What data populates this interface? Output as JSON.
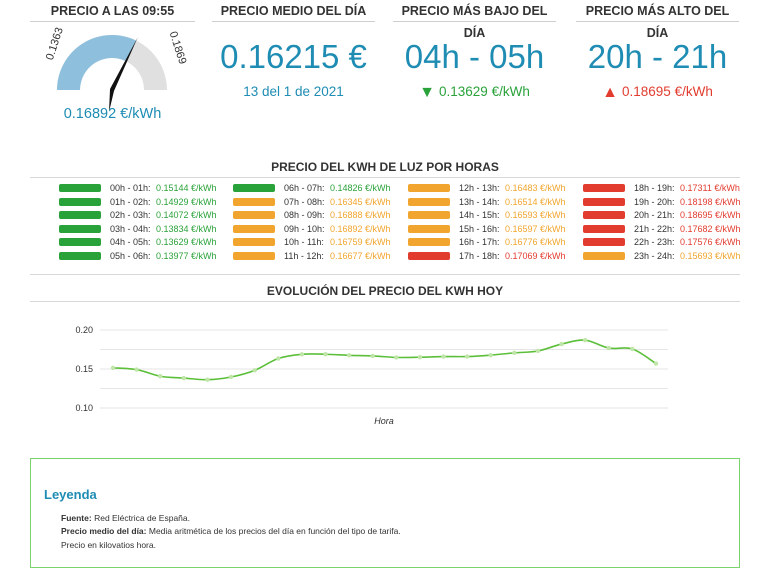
{
  "colors": {
    "accent": "#1e8cb3",
    "green": "#2aa23a",
    "orange": "#f2a52e",
    "red": "#e23c2f",
    "gauge_fill": "#8ec0dd",
    "gauge_bg": "#e0e0e0"
  },
  "current": {
    "title": "PRECIO A LAS 09:55",
    "gauge_min": "0.1363",
    "gauge_max": "0.1869",
    "gauge_value": 0.16892,
    "value_label": "0.16892 €/kWh"
  },
  "average": {
    "title": "PRECIO MEDIO DEL DÍA",
    "value": "0.16215 €",
    "date": "13 del 1 de 2021"
  },
  "lowest": {
    "title": "PRECIO MÁS BAJO DEL DÍA",
    "hours": "04h - 05h",
    "icon": "arrow-down-icon",
    "price": "0.13629 €/kWh"
  },
  "highest": {
    "title": "PRECIO MÁS ALTO DEL DÍA",
    "hours": "20h - 21h",
    "icon": "arrow-up-icon",
    "price": "0.18695 €/kWh"
  },
  "hourly": {
    "title": "PRECIO DEL KWH DE LUZ POR HORAS",
    "items": [
      {
        "range": "00h - 01h:",
        "price": "0.15144 €/kWh",
        "level": "green"
      },
      {
        "range": "01h - 02h:",
        "price": "0.14929 €/kWh",
        "level": "green"
      },
      {
        "range": "02h - 03h:",
        "price": "0.14072 €/kWh",
        "level": "green"
      },
      {
        "range": "03h - 04h:",
        "price": "0.13834 €/kWh",
        "level": "green"
      },
      {
        "range": "04h - 05h:",
        "price": "0.13629 €/kWh",
        "level": "green"
      },
      {
        "range": "05h - 06h:",
        "price": "0.13977 €/kWh",
        "level": "green"
      },
      {
        "range": "06h - 07h:",
        "price": "0.14826 €/kWh",
        "level": "green"
      },
      {
        "range": "07h - 08h:",
        "price": "0.16345 €/kWh",
        "level": "orange"
      },
      {
        "range": "08h - 09h:",
        "price": "0.16888 €/kWh",
        "level": "orange"
      },
      {
        "range": "09h - 10h:",
        "price": "0.16892 €/kWh",
        "level": "orange"
      },
      {
        "range": "10h - 11h:",
        "price": "0.16759 €/kWh",
        "level": "orange"
      },
      {
        "range": "11h - 12h:",
        "price": "0.16677 €/kWh",
        "level": "orange"
      },
      {
        "range": "12h - 13h:",
        "price": "0.16483 €/kWh",
        "level": "orange"
      },
      {
        "range": "13h - 14h:",
        "price": "0.16514 €/kWh",
        "level": "orange"
      },
      {
        "range": "14h - 15h:",
        "price": "0.16593 €/kWh",
        "level": "orange"
      },
      {
        "range": "15h - 16h:",
        "price": "0.16597 €/kWh",
        "level": "orange"
      },
      {
        "range": "16h - 17h:",
        "price": "0.16776 €/kWh",
        "level": "orange"
      },
      {
        "range": "17h - 18h:",
        "price": "0.17069 €/kWh",
        "level": "red"
      },
      {
        "range": "18h - 19h:",
        "price": "0.17311 €/kWh",
        "level": "red"
      },
      {
        "range": "19h - 20h:",
        "price": "0.18198 €/kWh",
        "level": "red"
      },
      {
        "range": "20h - 21h:",
        "price": "0.18695 €/kWh",
        "level": "red"
      },
      {
        "range": "21h - 22h:",
        "price": "0.17682 €/kWh",
        "level": "red"
      },
      {
        "range": "22h - 23h:",
        "price": "0.17576 €/kWh",
        "level": "red"
      },
      {
        "range": "23h - 24h:",
        "price": "0.15693 €/kWh",
        "level": "orange"
      }
    ]
  },
  "chart_data": {
    "type": "line",
    "title": "EVOLUCIÓN DEL PRECIO DEL KWH HOY",
    "xlabel": "Hora",
    "ylabel": "",
    "ylim": [
      0.1,
      0.2
    ],
    "yticks": [
      "0.20",
      "0.15",
      "0.10"
    ],
    "grid": true,
    "x": [
      0,
      1,
      2,
      3,
      4,
      5,
      6,
      7,
      8,
      9,
      10,
      11,
      12,
      13,
      14,
      15,
      16,
      17,
      18,
      19,
      20,
      21,
      22,
      23
    ],
    "series": [
      {
        "values": [
          0.15144,
          0.14929,
          0.14072,
          0.13834,
          0.13629,
          0.13977,
          0.14826,
          0.16345,
          0.16888,
          0.16892,
          0.16759,
          0.16677,
          0.16483,
          0.16514,
          0.16593,
          0.16597,
          0.16776,
          0.17069,
          0.17311,
          0.18198,
          0.18695,
          0.17682,
          0.17576,
          0.15693
        ]
      }
    ]
  },
  "legend": {
    "title": "Leyenda",
    "source_label": "Fuente:",
    "source_text": "Red Eléctrica de España.",
    "avg_label": "Precio medio del día:",
    "avg_text": "Media aritmética de los precios del día en función del tipo de tarifa.",
    "unit_text": "Precio en kilovatios hora."
  }
}
